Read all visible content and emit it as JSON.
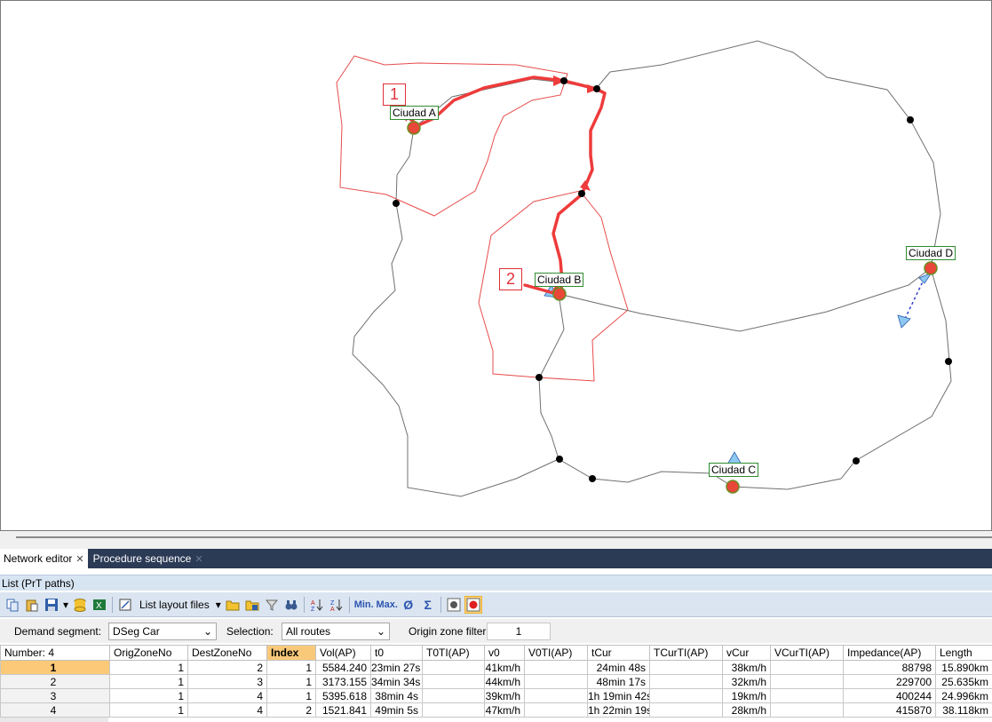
{
  "map": {
    "zones": {
      "a": "Ciudad A",
      "b": "Ciudad B",
      "c": "Ciudad C",
      "d": "Ciudad D"
    },
    "path_labels": [
      "1",
      "2"
    ]
  },
  "tabs": [
    {
      "label": "Network editor",
      "active": true
    },
    {
      "label": "Procedure sequence",
      "active": false
    }
  ],
  "list": {
    "title": "List (PrT paths)",
    "toolbar": {
      "layout_files_label": "List layout files",
      "min_label": "Min.",
      "max_label": "Max.",
      "avg_label": "Ø",
      "sum_label": "Σ"
    },
    "filters": {
      "demand_segment_label": "Demand segment:",
      "demand_segment_value": "DSeg Car",
      "selection_label": "Selection:",
      "selection_value": "All routes",
      "origin_zone_label": "Origin zone filter:",
      "origin_zone_value": "1"
    },
    "columns": [
      "Number: 4",
      "OrigZoneNo",
      "DestZoneNo",
      "Index",
      "Vol(AP)",
      "t0",
      "T0TI(AP)",
      "v0",
      "V0TI(AP)",
      "tCur",
      "TCurTI(AP)",
      "vCur",
      "VCurTI(AP)",
      "Impedance(AP)",
      "Length"
    ],
    "rows": [
      [
        "1",
        "1",
        "2",
        "1",
        "5584.240",
        "23min 27s",
        "",
        "41km/h",
        "",
        "24min 48s",
        "",
        "38km/h",
        "",
        "88798",
        "15.890km"
      ],
      [
        "2",
        "1",
        "3",
        "1",
        "3173.155",
        "34min 34s",
        "",
        "44km/h",
        "",
        "48min 17s",
        "",
        "32km/h",
        "",
        "229700",
        "25.635km"
      ],
      [
        "3",
        "1",
        "4",
        "1",
        "5395.618",
        "38min 4s",
        "",
        "39km/h",
        "",
        "1h 19min 42s",
        "",
        "19km/h",
        "",
        "400244",
        "24.996km"
      ],
      [
        "4",
        "1",
        "4",
        "2",
        "1521.841",
        "49min 5s",
        "",
        "47km/h",
        "",
        "1h 22min 19s",
        "",
        "28km/h",
        "",
        "415870",
        "38.118km"
      ]
    ]
  },
  "colors": {
    "route": "#ee3b3b",
    "zone_node": "#e8473a",
    "label_border": "#2e8b2e",
    "tab_bar": "#2b3a55",
    "sorted_header": "#f9c97a"
  }
}
